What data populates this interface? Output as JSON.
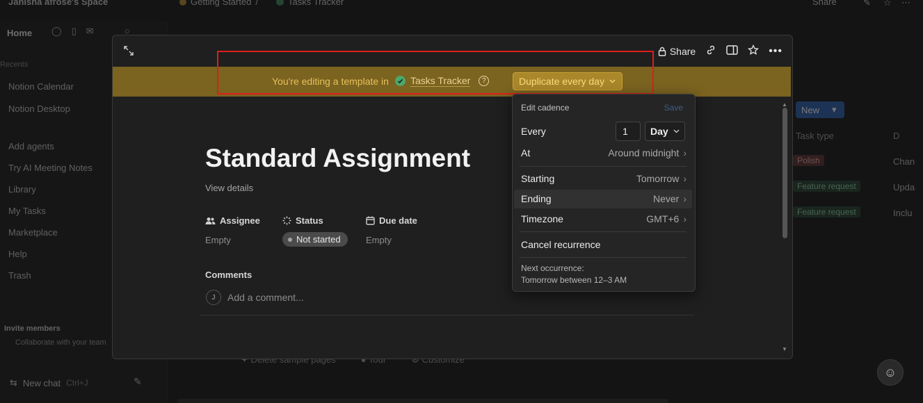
{
  "topbar": {
    "workspace": "Jahisha afrose's Space",
    "breadcrumbs": [
      "Getting Started",
      "Tasks Tracker"
    ],
    "share": "Share"
  },
  "sidebar": {
    "home": "Home",
    "section_label": "Recents",
    "items": [
      "Notion Calendar",
      "Notion Desktop",
      "Add agents",
      "Try AI Meeting Notes",
      "Library",
      "My Tasks",
      "Marketplace",
      "Help",
      "Trash"
    ],
    "invite_title": "Invite members",
    "invite_sub": "Collaborate with your team",
    "new_chat": "New chat",
    "new_chat_shortcut": "Ctrl+J"
  },
  "main": {
    "new_button": "New",
    "columns": [
      "Task type",
      "D"
    ],
    "rows": [
      {
        "tag": "Polish",
        "desc": "Chan"
      },
      {
        "tag": "Feature request",
        "desc": "Upda"
      },
      {
        "tag": "Feature request",
        "desc": "Inclu"
      }
    ],
    "below_actions": [
      "Delete sample pages",
      "Tour",
      "Customize"
    ]
  },
  "modal": {
    "actions": {
      "share": "Share"
    },
    "banner": {
      "prefix": "You're editing a template in",
      "database": "Tasks Tracker",
      "help": "?",
      "duplicate_button": "Duplicate every day"
    },
    "title": "Standard Assignment",
    "view_details": "View details",
    "properties": [
      {
        "label": "Assignee",
        "value": "Empty"
      },
      {
        "label": "Status",
        "value": "Not started"
      },
      {
        "label": "Due date",
        "value": "Empty"
      }
    ],
    "comments_label": "Comments",
    "avatar_initial": "J",
    "comment_placeholder": "Add a comment..."
  },
  "cadence": {
    "title": "Edit cadence",
    "save": "Save",
    "every_label": "Every",
    "every_value": "1",
    "every_unit": "Day",
    "at_label": "At",
    "at_value": "Around midnight",
    "starting_label": "Starting",
    "starting_value": "Tomorrow",
    "ending_label": "Ending",
    "ending_value": "Never",
    "timezone_label": "Timezone",
    "timezone_value": "GMT+6",
    "cancel": "Cancel recurrence",
    "next_label": "Next occurrence:",
    "next_value": "Tomorrow between 12–3 AM"
  },
  "colors": {
    "banner": "#7b6320",
    "duplicate_button": "#a9872a",
    "highlight_box": "#e01d1d",
    "check": "#4aa86b"
  }
}
